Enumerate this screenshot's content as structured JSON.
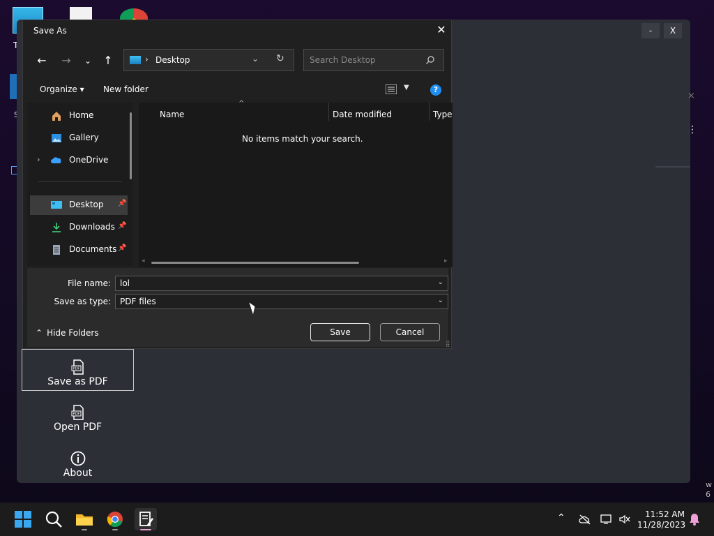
{
  "desktop": {
    "this_pc_label": "Th",
    "shortcut_label": "S"
  },
  "app": {
    "minimize_label": "-",
    "close_label": "X",
    "inner_close": "×",
    "menu_icon": "⋮",
    "right_edge_top": "w",
    "right_edge_bottom": "6",
    "tools": [
      {
        "label": "Save as PDF",
        "icon": "pdf-file-icon",
        "selected": true
      },
      {
        "label": "Open PDF",
        "icon": "pdf-file-icon",
        "selected": false
      },
      {
        "label": "About",
        "icon": "info-icon",
        "selected": false
      }
    ]
  },
  "dialog": {
    "title": "Save As",
    "close": "✕",
    "address": {
      "location": "Desktop",
      "separator": "›"
    },
    "search_placeholder": "Search Desktop",
    "commands": {
      "organize": "Organize ▾",
      "new_folder": "New folder"
    },
    "help": "?",
    "nav_items": [
      {
        "label": "Home",
        "icon": "home-icon",
        "pinned": false
      },
      {
        "label": "Gallery",
        "icon": "gallery-icon",
        "pinned": false
      },
      {
        "label": "OneDrive",
        "icon": "onedrive-icon",
        "pinned": false,
        "expandable": true
      },
      {
        "label": "Desktop",
        "icon": "desktop-icon",
        "pinned": true,
        "active": true
      },
      {
        "label": "Downloads",
        "icon": "download-icon",
        "pinned": true
      },
      {
        "label": "Documents",
        "icon": "documents-icon",
        "pinned": true
      }
    ],
    "columns": [
      "Name",
      "Date modified",
      "Type"
    ],
    "empty_message": "No items match your search.",
    "file_name_label": "File name:",
    "file_name_value": "lol",
    "save_type_label": "Save as type:",
    "save_type_value": "PDF files",
    "hide_folders": "Hide Folders",
    "save_button": "Save",
    "cancel_button": "Cancel"
  },
  "taskbar": {
    "clock_time": "11:52 AM",
    "clock_date": "11/28/2023"
  }
}
